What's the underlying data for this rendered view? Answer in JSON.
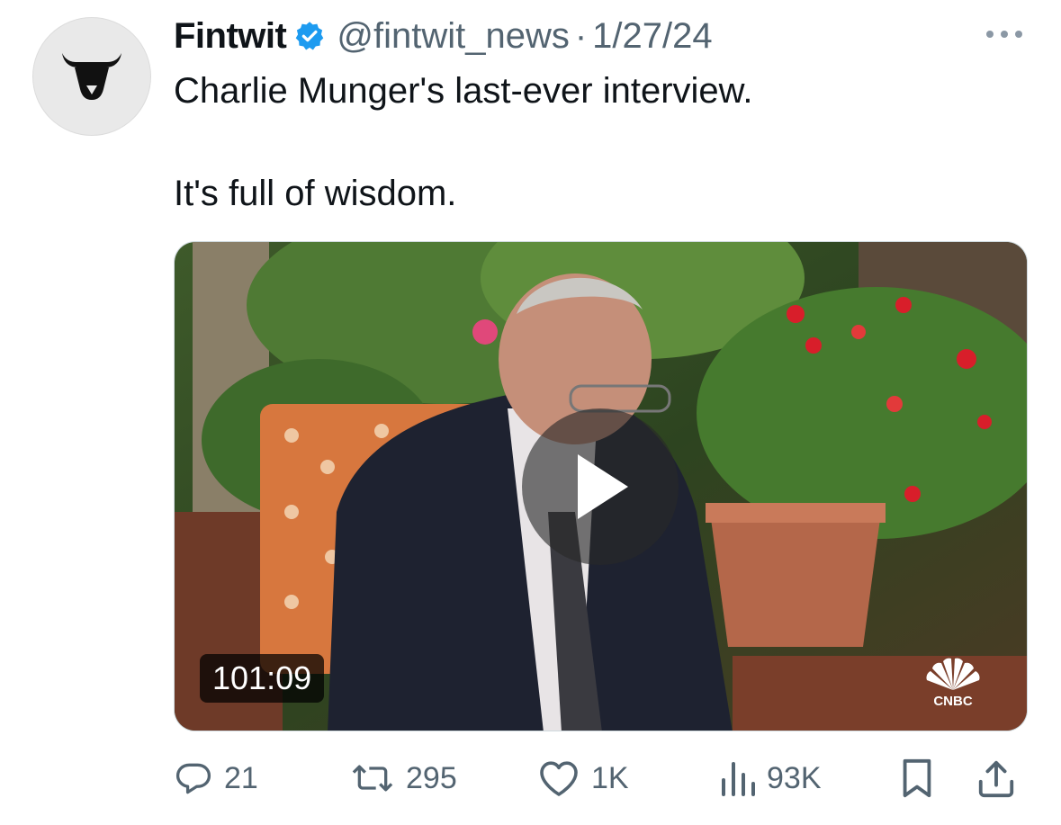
{
  "author": {
    "name": "Fintwit",
    "handle": "@fintwit_news",
    "date": "1/27/24",
    "avatar_icon": "bull-head-icon",
    "verified_icon": "verified-badge-icon"
  },
  "tweet": {
    "line1": "Charlie Munger's last-ever interview.",
    "line2": "It's full of wisdom."
  },
  "media": {
    "duration": "101:09",
    "watermark": "CNBC",
    "play_icon": "play-icon"
  },
  "actions": {
    "replies": "21",
    "retweets": "295",
    "likes": "1K",
    "views": "93K"
  },
  "colors": {
    "text": "#0f1419",
    "secondary": "#536471",
    "verified": "#1d9bf0"
  }
}
